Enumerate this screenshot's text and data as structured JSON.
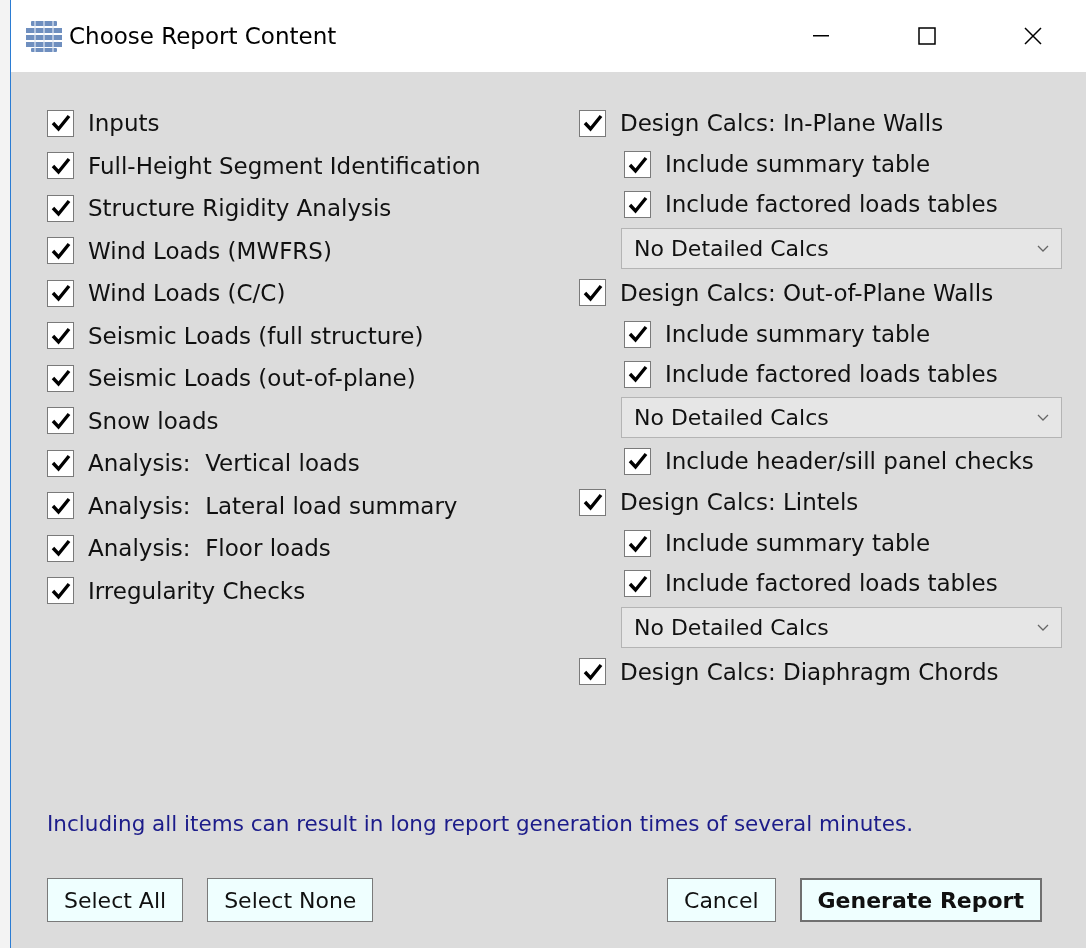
{
  "window": {
    "title": "Choose Report Content"
  },
  "left_items": [
    {
      "label": "Inputs",
      "checked": true
    },
    {
      "label": "Full-Height Segment Identification",
      "checked": true
    },
    {
      "label": "Structure Rigidity Analysis",
      "checked": true
    },
    {
      "label": "Wind Loads (MWFRS)",
      "checked": true
    },
    {
      "label": "Wind Loads (C/C)",
      "checked": true
    },
    {
      "label": "Seismic Loads (full structure)",
      "checked": true
    },
    {
      "label": "Seismic Loads (out-of-plane)",
      "checked": true
    },
    {
      "label": "Snow loads",
      "checked": true
    },
    {
      "label": "Analysis:  Vertical loads",
      "checked": true
    },
    {
      "label": "Analysis:  Lateral load summary",
      "checked": true
    },
    {
      "label": "Analysis:  Floor loads",
      "checked": true
    },
    {
      "label": "Irregularity Checks",
      "checked": true
    }
  ],
  "right_items": [
    {
      "kind": "check",
      "label": "Design Calcs: In-Plane Walls",
      "checked": true
    },
    {
      "kind": "subcheck",
      "label": "Include summary table",
      "checked": true
    },
    {
      "kind": "subcheck",
      "label": "Include factored loads tables",
      "checked": true
    },
    {
      "kind": "dropdown",
      "value": "No Detailed Calcs"
    },
    {
      "kind": "check",
      "label": "Design Calcs: Out-of-Plane Walls",
      "checked": true
    },
    {
      "kind": "subcheck",
      "label": "Include summary table",
      "checked": true
    },
    {
      "kind": "subcheck",
      "label": "Include factored loads tables",
      "checked": true
    },
    {
      "kind": "dropdown",
      "value": "No Detailed Calcs"
    },
    {
      "kind": "subcheck",
      "label": "Include header/sill panel checks",
      "checked": true
    },
    {
      "kind": "check",
      "label": "Design Calcs: Lintels",
      "checked": true
    },
    {
      "kind": "subcheck",
      "label": "Include summary table",
      "checked": true
    },
    {
      "kind": "subcheck",
      "label": "Include factored loads tables",
      "checked": true
    },
    {
      "kind": "dropdown",
      "value": "No Detailed Calcs"
    },
    {
      "kind": "check",
      "label": "Design Calcs: Diaphragm Chords",
      "checked": true
    }
  ],
  "note": "Including all items can result in long report generation times of several minutes.",
  "left_buttons": [
    {
      "label": "Select All",
      "default": false
    },
    {
      "label": "Select None",
      "default": false
    }
  ],
  "right_buttons": [
    {
      "label": "Cancel",
      "default": false
    },
    {
      "label": "Generate Report",
      "default": true
    }
  ]
}
